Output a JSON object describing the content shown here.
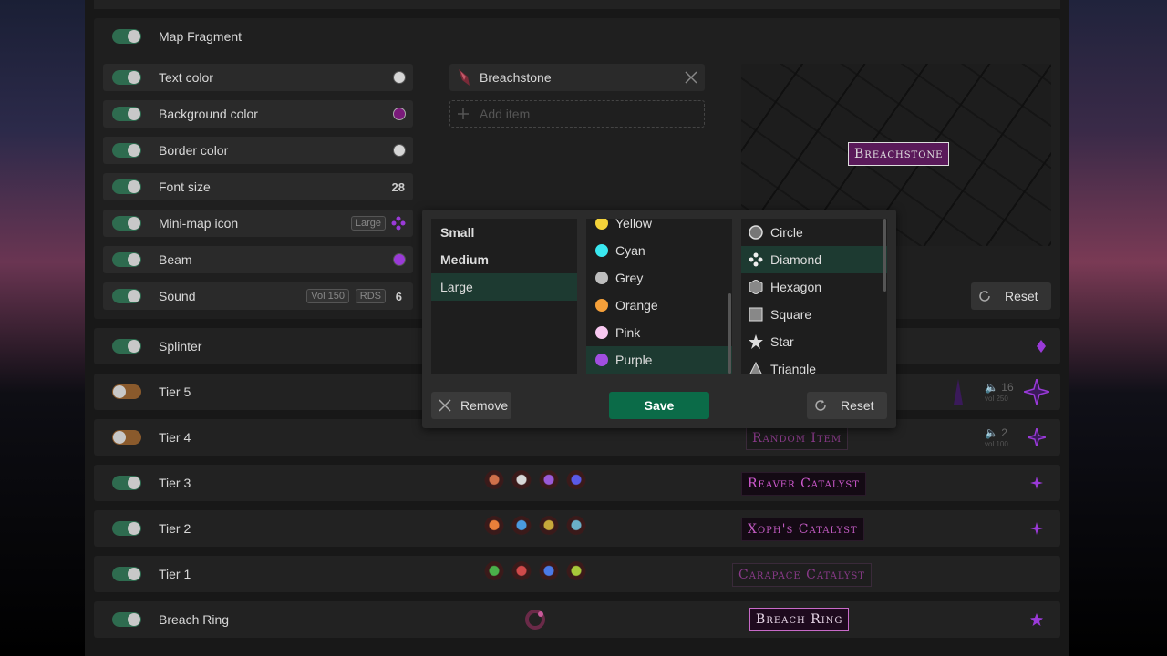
{
  "section": {
    "title": "Map Fragment"
  },
  "settings": [
    {
      "label": "Text color",
      "color": "#d6d6d6"
    },
    {
      "label": "Background color",
      "color": "#7a1a7a"
    },
    {
      "label": "Border color",
      "color": "#d6d6d6"
    },
    {
      "label": "Font size",
      "value": "28"
    },
    {
      "label": "Mini-map icon",
      "badge": "Large",
      "icon": "diamond-icon",
      "color": "#9a3ad8"
    },
    {
      "label": "Beam",
      "color": "#9a3ad8"
    },
    {
      "label": "Sound",
      "vol": "Vol 150",
      "rds": "RDS",
      "value": "6"
    }
  ],
  "item": {
    "name": "Breachstone",
    "add_placeholder": "Add item"
  },
  "preview": {
    "tag": "Breachstone",
    "reset": "Reset"
  },
  "popup": {
    "sizes": [
      "Small",
      "Medium",
      "Large"
    ],
    "selected_size": "Large",
    "colors": [
      {
        "name": "Yellow",
        "hex": "#f3d23a"
      },
      {
        "name": "Cyan",
        "hex": "#3ae8f0"
      },
      {
        "name": "Grey",
        "hex": "#bdbdbd"
      },
      {
        "name": "Orange",
        "hex": "#f5a03a"
      },
      {
        "name": "Pink",
        "hex": "#f8c8f0"
      },
      {
        "name": "Purple",
        "hex": "#a04ee0"
      }
    ],
    "selected_color": "Purple",
    "shapes": [
      {
        "name": "Circle",
        "icon": "circle-icon"
      },
      {
        "name": "Diamond",
        "icon": "diamond-icon"
      },
      {
        "name": "Hexagon",
        "icon": "hexagon-icon"
      },
      {
        "name": "Square",
        "icon": "square-icon"
      },
      {
        "name": "Star",
        "icon": "star-icon"
      },
      {
        "name": "Triangle",
        "icon": "triangle-icon"
      }
    ],
    "selected_shape": "Diamond",
    "remove": "Remove",
    "save": "Save",
    "reset": "Reset"
  },
  "rows": [
    {
      "label": "Splinter",
      "enabled": true
    },
    {
      "label": "Tier 5",
      "enabled": false,
      "sound": "16",
      "vol": "vol 250"
    },
    {
      "label": "Tier 4",
      "enabled": false,
      "sound": "2",
      "vol": "vol 100",
      "tag": "Random Item"
    },
    {
      "label": "Tier 3",
      "enabled": true,
      "tag": "Reaver Catalyst"
    },
    {
      "label": "Tier 2",
      "enabled": true,
      "tag": "Xoph's Catalyst"
    },
    {
      "label": "Tier 1",
      "enabled": true,
      "tag": "Carapace Catalyst"
    },
    {
      "label": "Breach Ring",
      "enabled": true,
      "tag": "Breach Ring"
    }
  ]
}
